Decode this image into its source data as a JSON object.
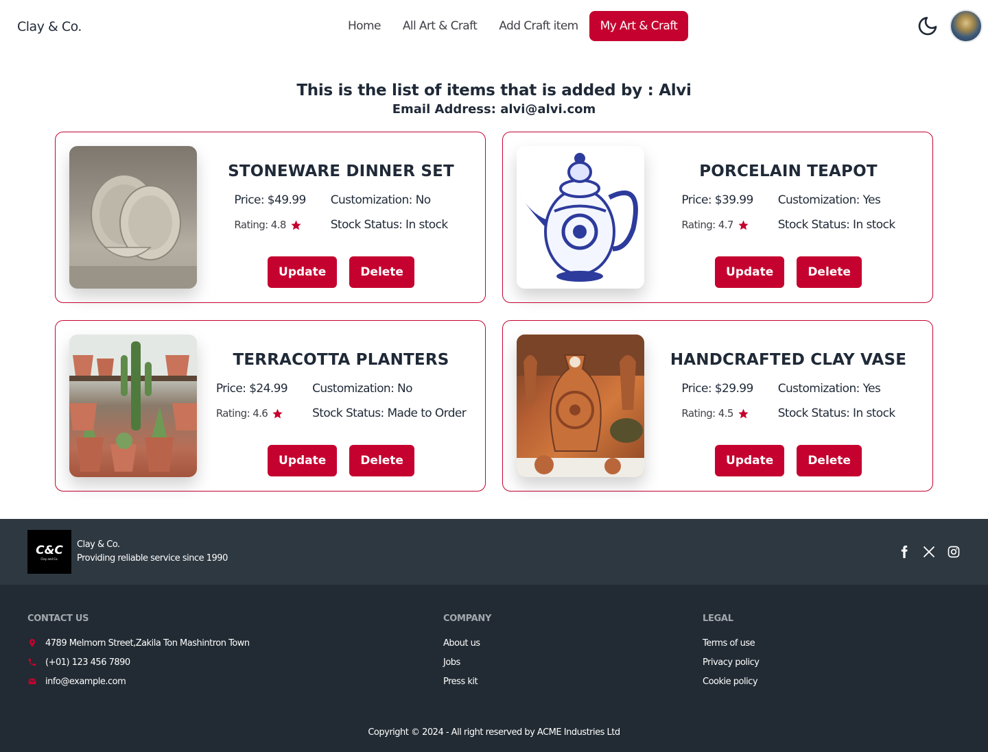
{
  "brand": "Clay & Co.",
  "nav": {
    "items": [
      {
        "label": "Home",
        "active": false
      },
      {
        "label": "All Art & Craft",
        "active": false
      },
      {
        "label": "Add Craft item",
        "active": false
      },
      {
        "label": "My Art & Craft",
        "active": true
      }
    ],
    "theme_icon": "moon-icon",
    "avatar": "user-avatar"
  },
  "heading": {
    "title": "This is the list of items that is added by : Alvi",
    "email": "Email Address: alvi@alvi.com"
  },
  "colors": {
    "accent": "#c5022f",
    "footer_top": "#2e3840",
    "footer_main": "#222b33"
  },
  "items": [
    {
      "name": "STONEWARE DINNER SET",
      "price": "Price: $49.99",
      "customization": "Customization: No",
      "rating": "Rating: 4.8",
      "stock": "Stock Status: In stock",
      "update_label": "Update",
      "delete_label": "Delete"
    },
    {
      "name": "PORCELAIN TEAPOT",
      "price": "Price: $39.99",
      "customization": "Customization: Yes",
      "rating": "Rating: 4.7",
      "stock": "Stock Status: In stock",
      "update_label": "Update",
      "delete_label": "Delete"
    },
    {
      "name": "TERRACOTTA PLANTERS",
      "price": "Price: $24.99",
      "customization": "Customization: No",
      "rating": "Rating: 4.6",
      "stock": "Stock Status: Made to Order",
      "update_label": "Update",
      "delete_label": "Delete"
    },
    {
      "name": "HANDCRAFTED CLAY VASE",
      "price": "Price: $29.99",
      "customization": "Customization: Yes",
      "rating": "Rating: 4.5",
      "stock": "Stock Status: In stock",
      "update_label": "Update",
      "delete_label": "Delete"
    }
  ],
  "footer": {
    "logo_text": "C&C",
    "logo_sub": "Clay and Co.",
    "brand_name": "Clay & Co.",
    "tagline": "Providing reliable service since 1990",
    "socials": [
      "facebook-icon",
      "x-icon",
      "instagram-icon"
    ],
    "contact": {
      "title": "CONTACT US",
      "address": "4789 Melmorn Street,Zakila Ton Mashintron Town",
      "phone": "(+01) 123 456 7890",
      "email": "info@example.com"
    },
    "company": {
      "title": "COMPANY",
      "links": [
        "About us",
        "Jobs",
        "Press kit"
      ]
    },
    "legal": {
      "title": "LEGAL",
      "links": [
        "Terms of use",
        "Privacy policy",
        "Cookie policy"
      ]
    },
    "copyright": "Copyright © 2024 - All right reserved by ACME Industries Ltd"
  }
}
